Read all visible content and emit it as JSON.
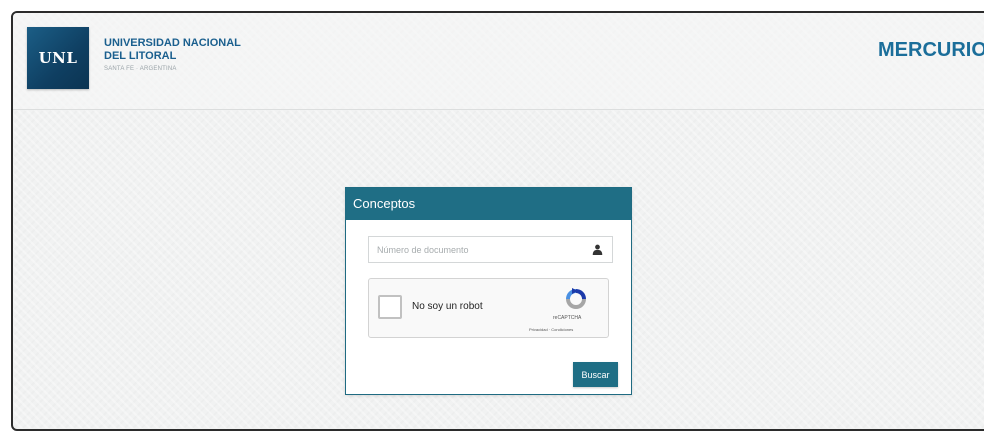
{
  "header": {
    "logo_text": "UNL",
    "university_line1": "UNIVERSIDAD NACIONAL",
    "university_line2": "DEL LITORAL",
    "university_city": "SANTA FE · ARGENTINA",
    "brand": "MERCURIO"
  },
  "panel": {
    "title": "Conceptos",
    "document_field": {
      "placeholder": "Número de documento",
      "value": ""
    },
    "captcha": {
      "label": "No soy un robot",
      "brand": "reCAPTCHA",
      "links": "Privacidad · Condiciones",
      "checked": false
    },
    "submit_label": "Buscar"
  },
  "colors": {
    "primary": "#1f6e85",
    "brand_text": "#1b6e9a",
    "logo_bg": "#0f3f62"
  }
}
